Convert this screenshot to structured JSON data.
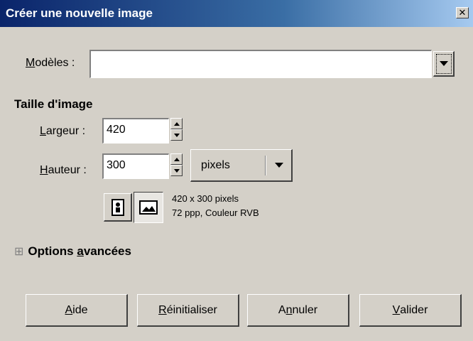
{
  "window": {
    "title": "Créer une nouvelle image",
    "close_glyph": "✕"
  },
  "template": {
    "label_first": "M",
    "label_rest": "odèles :",
    "value": ""
  },
  "size_section": {
    "heading": "Taille d'image"
  },
  "width": {
    "label_first": "L",
    "label_rest": "argeur :",
    "value": "420"
  },
  "height": {
    "label_first": "H",
    "label_rest": "auteur :",
    "value": "300"
  },
  "unit": {
    "selected": "pixels"
  },
  "orientation": {
    "portrait_icon": "portrait-icon",
    "landscape_icon": "landscape-icon",
    "selected": "landscape"
  },
  "info": {
    "line1": "420 x 300 pixels",
    "line2": "72 ppp, Couleur RVB"
  },
  "advanced": {
    "expander": "⊞",
    "label_a": "Options ",
    "label_u": "a",
    "label_b": "vancées"
  },
  "buttons": {
    "help": {
      "u": "A",
      "rest": "ide"
    },
    "reset": {
      "u": "R",
      "rest": "éinitialiser"
    },
    "cancel": {
      "pre": "A",
      "u": "n",
      "rest": "nuler"
    },
    "ok": {
      "u": "V",
      "rest": "alider"
    }
  },
  "colors": {
    "title_start": "#0a246a",
    "title_end": "#a6caf0",
    "face": "#d4d0c8"
  }
}
